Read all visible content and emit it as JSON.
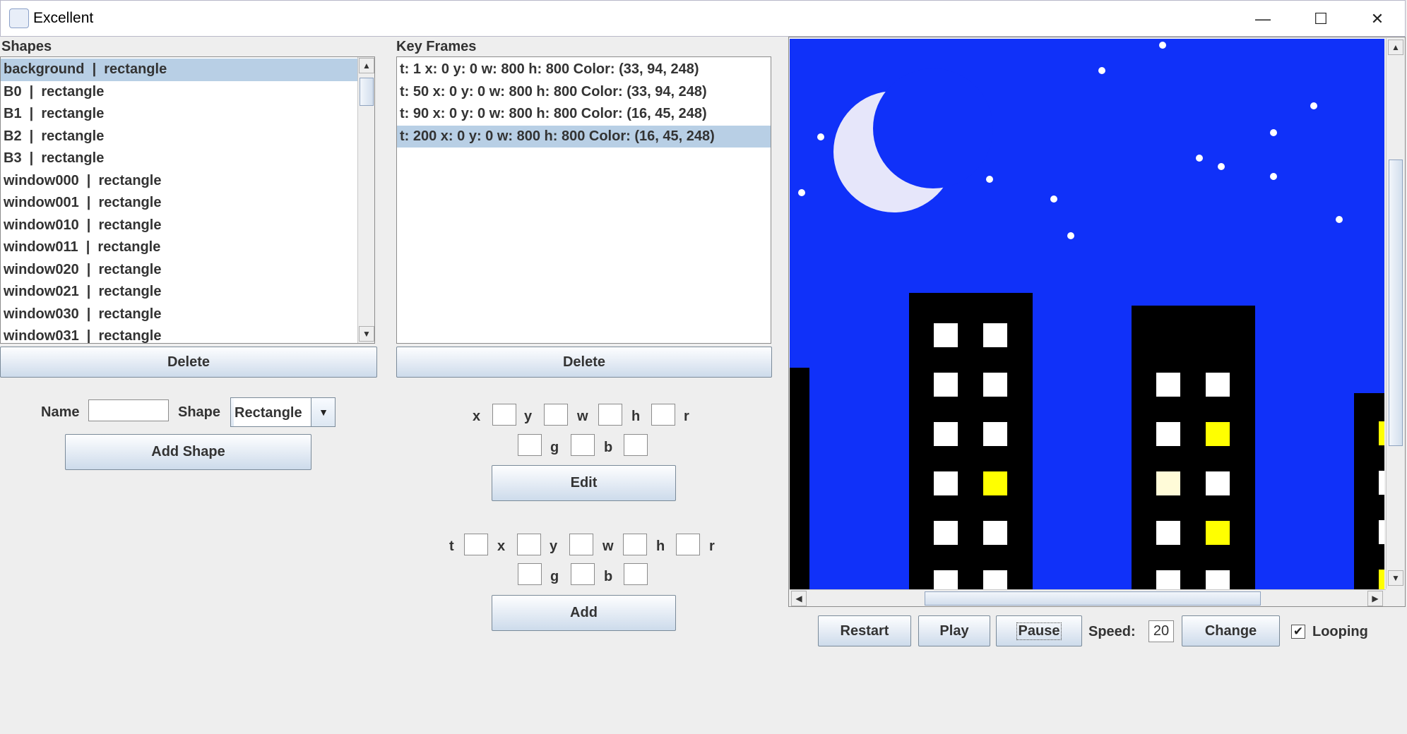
{
  "window": {
    "title": "Excellent",
    "minimize": "—",
    "maximize": "☐",
    "close": "✕"
  },
  "shapes_panel": {
    "label": "Shapes",
    "items": [
      "background  |  rectangle",
      "B0  |  rectangle",
      "B1  |  rectangle",
      "B2  |  rectangle",
      "B3  |  rectangle",
      "window000  |  rectangle",
      "window001  |  rectangle",
      "window010  |  rectangle",
      "window011  |  rectangle",
      "window020  |  rectangle",
      "window021  |  rectangle",
      "window030  |  rectangle",
      "window031  |  rectangle"
    ],
    "selected_index": 0,
    "delete_label": "Delete"
  },
  "keyframes_panel": {
    "label": "Key Frames",
    "items": [
      "t: 1 x: 0 y: 0 w: 800 h: 800 Color: (33, 94, 248)",
      "t: 50 x: 0 y: 0 w: 800 h: 800 Color: (33, 94, 248)",
      "t: 90 x: 0 y: 0 w: 800 h: 800 Color: (16, 45, 248)",
      "t: 200 x: 0 y: 0 w: 800 h: 800 Color: (16, 45, 248)"
    ],
    "selected_index": 3,
    "delete_label": "Delete"
  },
  "add_shape": {
    "name_label": "Name",
    "name_value": "",
    "shape_label": "Shape",
    "shape_value": "Rectangle",
    "button_label": "Add Shape"
  },
  "edit_form": {
    "x_label": "x",
    "y_label": "y",
    "w_label": "w",
    "h_label": "h",
    "r_label": "r",
    "g_label": "g",
    "b_label": "b",
    "button_label": "Edit"
  },
  "add_form": {
    "t_label": "t",
    "x_label": "x",
    "y_label": "y",
    "w_label": "w",
    "h_label": "h",
    "r_label": "r",
    "g_label": "g",
    "b_label": "b",
    "button_label": "Add"
  },
  "controls": {
    "restart_label": "Restart",
    "play_label": "Play",
    "pause_label": "Pause",
    "speed_label": "Speed:",
    "speed_value": "20",
    "change_label": "Change",
    "looping_label": "Looping",
    "looping_checked": true
  },
  "colors": {
    "sky": "#1031f9",
    "moon": "#e6e6fa",
    "window_white": "#ffffff",
    "window_yellow": "#ffff00",
    "window_cream": "#fffbd8",
    "selection": "#b8cfe5"
  }
}
